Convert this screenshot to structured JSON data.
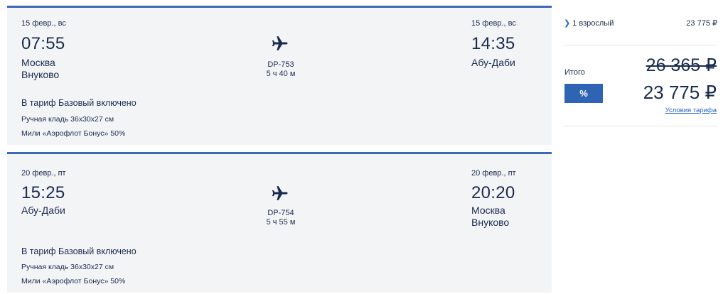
{
  "flights": [
    {
      "dep_date": "15 февр., вс",
      "dep_time": "07:55",
      "dep_city": "Москва",
      "dep_airport": "Внуково",
      "flight_no": "DP-753",
      "duration": "5 ч 40 м",
      "arr_date": "15 февр., вс",
      "arr_time": "14:35",
      "arr_city": "Абу-Даби",
      "arr_airport": "",
      "tariff": "В тариф Базовый включено",
      "features": [
        "Ручная кладь 36х30х27 см",
        "Мили «Аэрофлот Бонус» 50%"
      ]
    },
    {
      "dep_date": "20 февр., пт",
      "dep_time": "15:25",
      "dep_city": "Абу-Даби",
      "dep_airport": "",
      "flight_no": "DP-754",
      "duration": "5 ч 55 м",
      "arr_date": "20 февр., пт",
      "arr_time": "20:20",
      "arr_city": "Москва",
      "arr_airport": "Внуково",
      "tariff": "В тариф Базовый включено",
      "features": [
        "Ручная кладь 36х30х27 см",
        "Мили «Аэрофлот Бонус» 50%"
      ]
    }
  ],
  "summary": {
    "passengers_label": "1 взрослый",
    "passengers_price": "23 775 ₽",
    "total_label": "Итого",
    "old_price": "26 365 ₽",
    "discount_button": "%",
    "new_price": "23 775 ₽",
    "terms_link": "Условия тарифа"
  },
  "icons": {
    "plane": "plane-icon",
    "chevron": "chevron-right-icon"
  },
  "colors": {
    "accent": "#2f63b4",
    "text": "#1a2b4e",
    "card_bg": "#f3f4f6",
    "card_border": "#3b6ab5"
  }
}
